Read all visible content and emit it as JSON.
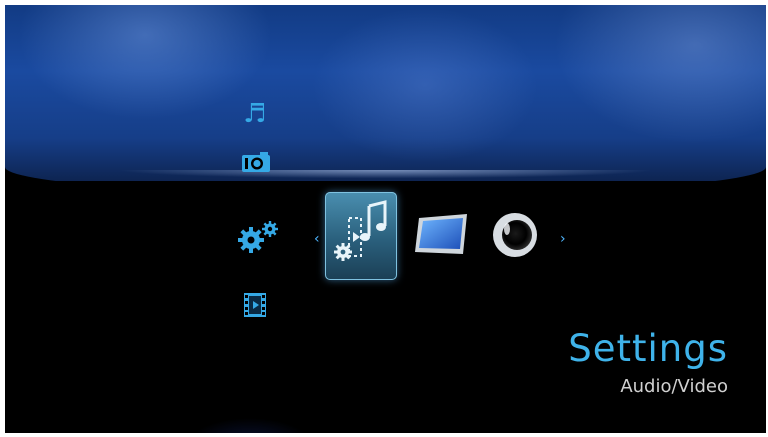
{
  "menu": {
    "categories": [
      {
        "name": "music",
        "icon": "music-note-icon"
      },
      {
        "name": "photo",
        "icon": "camera-icon"
      },
      {
        "name": "settings",
        "icon": "gears-icon"
      },
      {
        "name": "video",
        "icon": "film-icon"
      }
    ],
    "active_category": "settings"
  },
  "submenu": {
    "items": [
      {
        "icon": "audio-video-icon",
        "selected": true
      },
      {
        "icon": "display-icon",
        "selected": false
      },
      {
        "icon": "audio-speaker-icon",
        "selected": false
      }
    ],
    "left_arrow": "‹",
    "right_arrow": "›"
  },
  "info": {
    "title": "Settings",
    "subtitle": "Audio/Video"
  },
  "colors": {
    "accent": "#3fb3ea",
    "sky_top": "#123b84",
    "background": "#000000"
  }
}
